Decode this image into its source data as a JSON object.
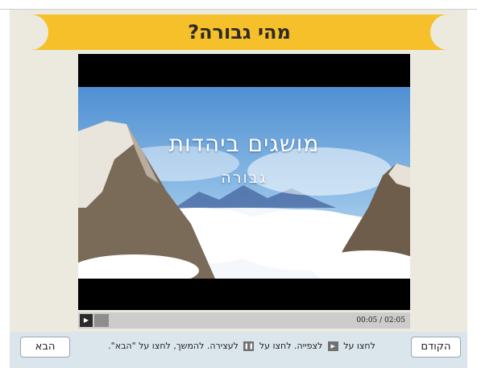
{
  "lesson": {
    "title": "מהי גבורה?"
  },
  "video": {
    "title_line1": "מושגים ביהדות",
    "title_line2": "גבורה"
  },
  "player": {
    "current_time": "00:05",
    "separator": "/",
    "duration": "02:05",
    "progress": 0.04
  },
  "footer": {
    "instr_part1": "לחצו על",
    "instr_part2": "לצפייה. לחצו על",
    "instr_part3": "לעצירה. להמשך, לחצו על \"הבא\".",
    "next_label": "הבא",
    "prev_label": "הקודם"
  },
  "icons": {
    "play": "play-icon",
    "pause": "pause-icon"
  }
}
